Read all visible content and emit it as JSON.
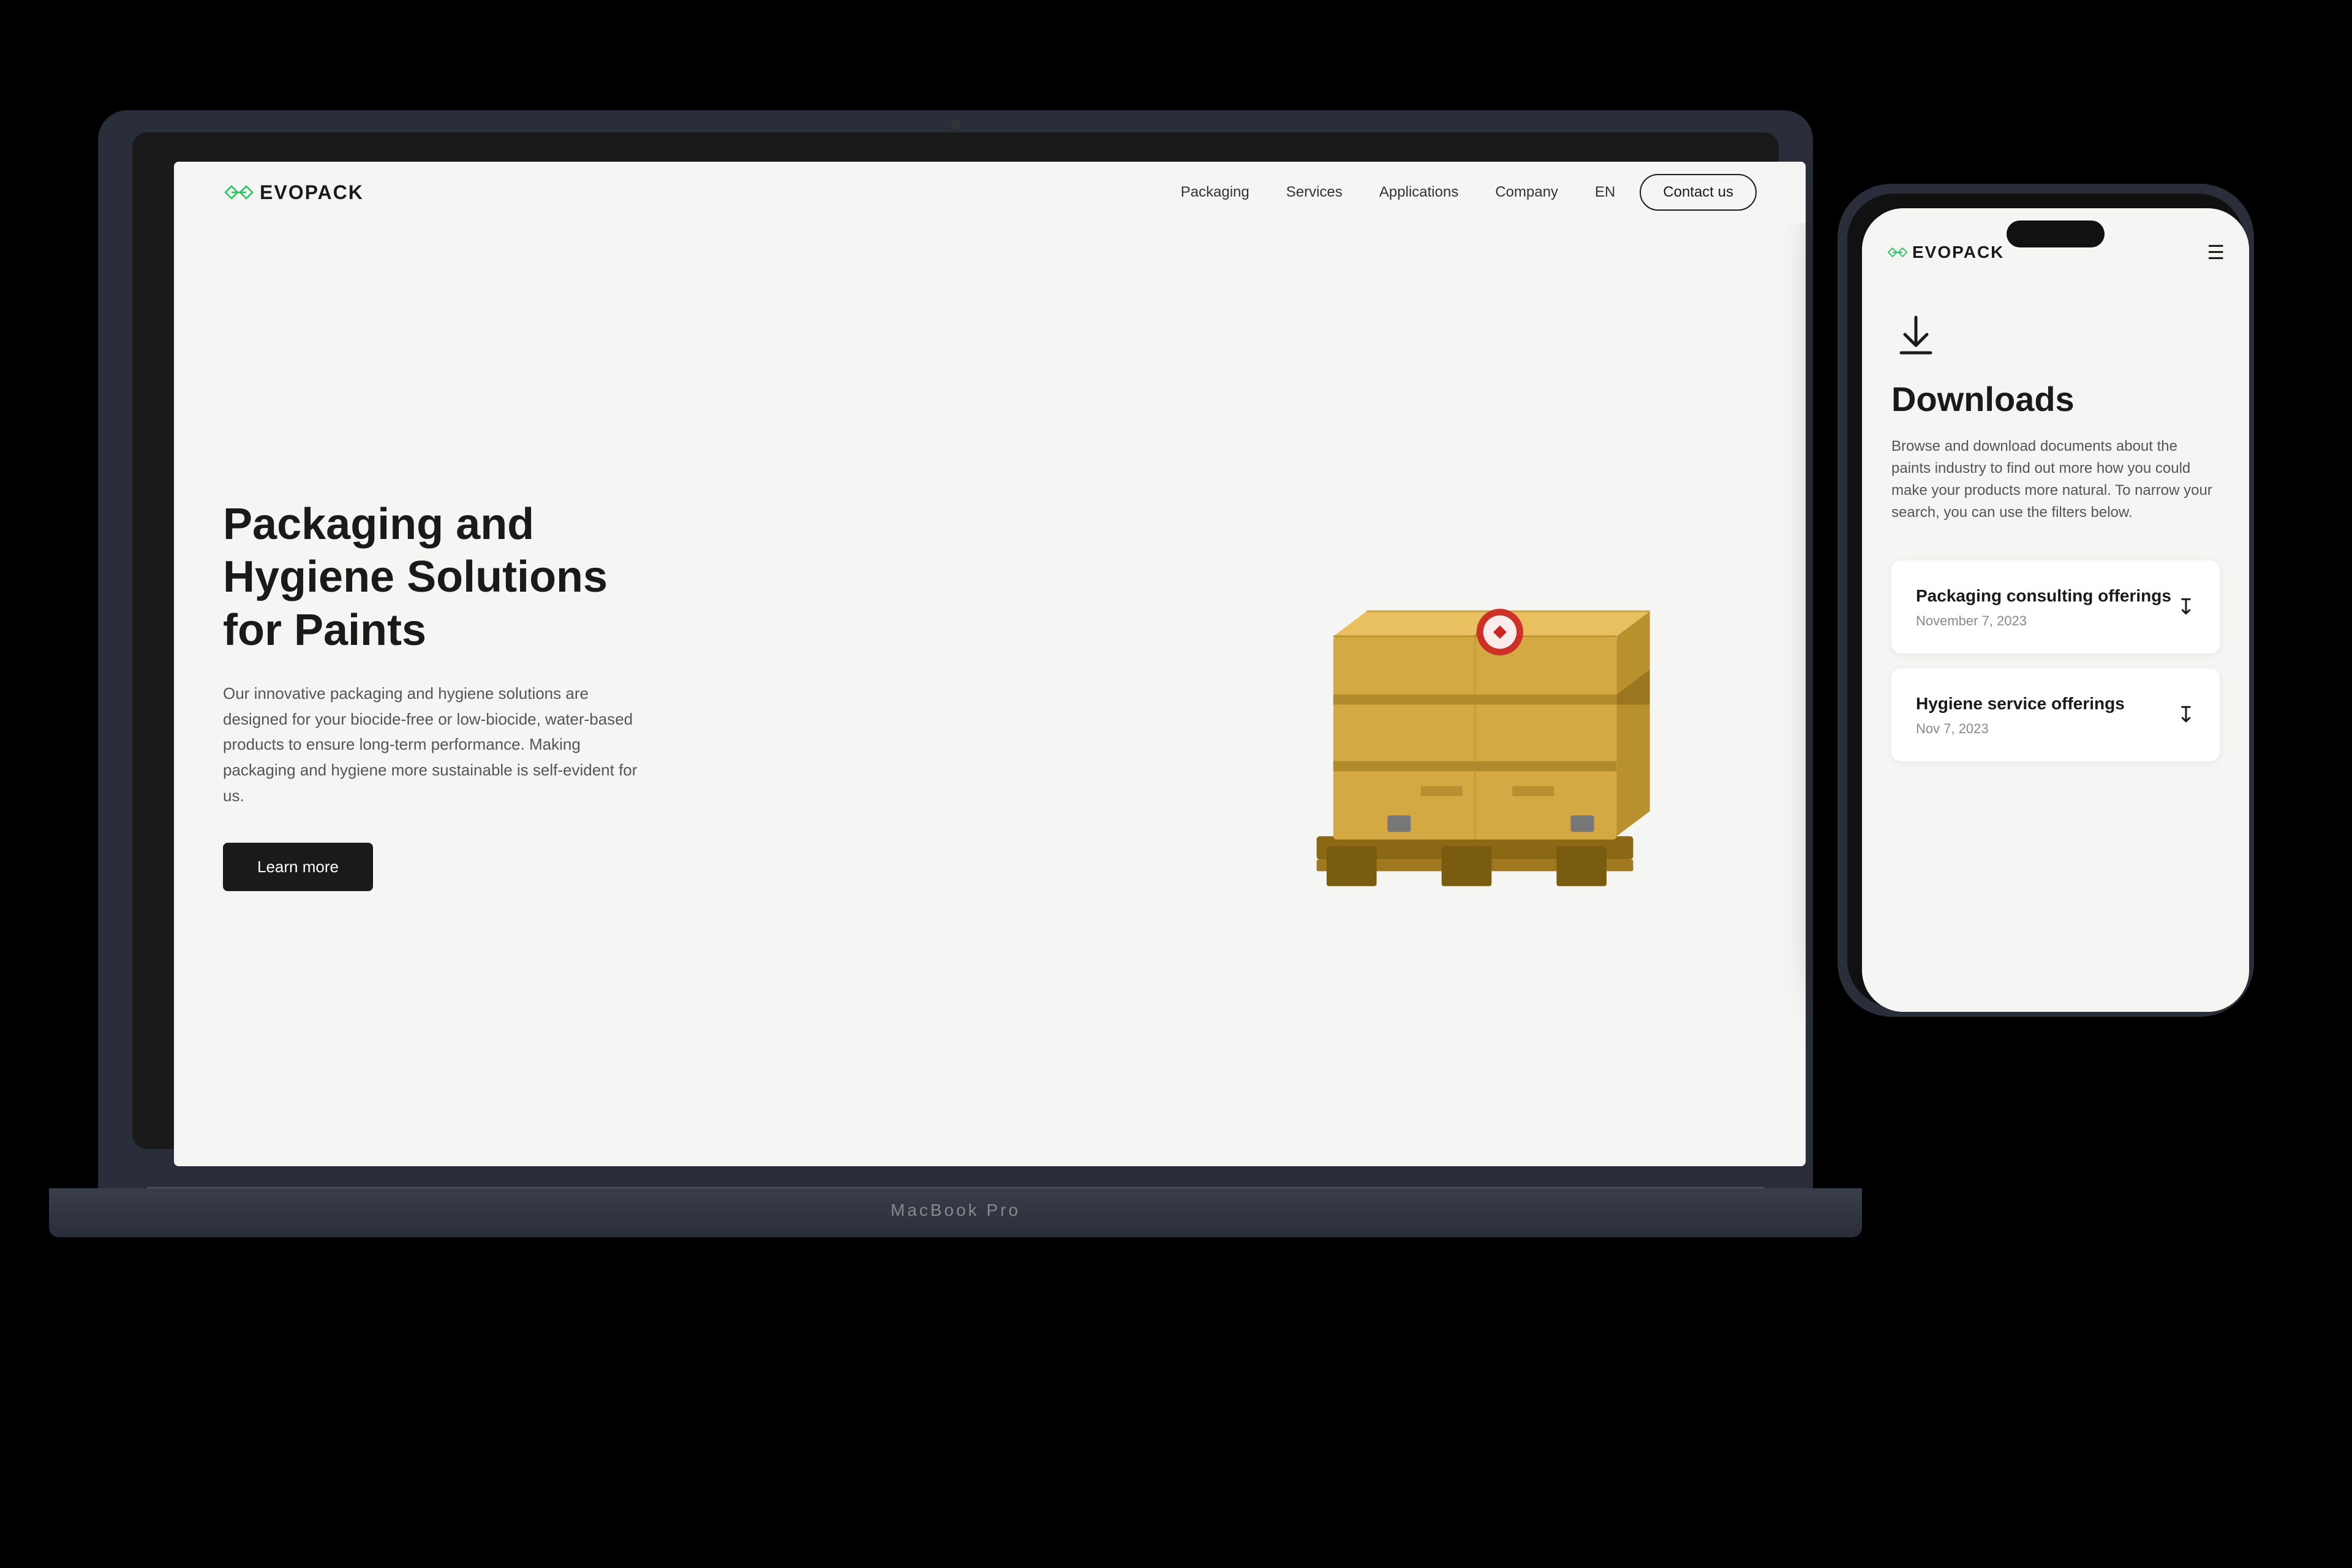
{
  "laptop": {
    "model_label": "MacBook Pro"
  },
  "website": {
    "logo": {
      "text": "EVOPACK",
      "icon_name": "evopack-logo-icon"
    },
    "nav": {
      "items": [
        {
          "label": "Packaging",
          "href": "#"
        },
        {
          "label": "Services",
          "href": "#"
        },
        {
          "label": "Applications",
          "href": "#"
        },
        {
          "label": "Company",
          "href": "#"
        },
        {
          "label": "EN",
          "href": "#"
        }
      ],
      "contact_button": "Contact us"
    },
    "hero": {
      "title": "Packaging and Hygiene Solutions for Paints",
      "description": "Our innovative packaging and hygiene solutions are designed for your biocide-free or low-biocide, water-based products to ensure long-term performance. Making packaging and hygiene more sustainable is self-evident for us.",
      "cta_label": "Learn more"
    }
  },
  "phone": {
    "logo": {
      "text": "EVOPACK"
    },
    "page": {
      "icon_name": "download-icon",
      "title": "Downloads",
      "description": "Browse and download documents about the paints industry to find out more how you could make your products more natural. To narrow your search, you can use the filters below.",
      "items": [
        {
          "title": "Packaging consulting offerings",
          "date": "November 7, 2023"
        },
        {
          "title": "Hygiene service offerings",
          "date": "Nov 7, 2023"
        }
      ]
    }
  }
}
